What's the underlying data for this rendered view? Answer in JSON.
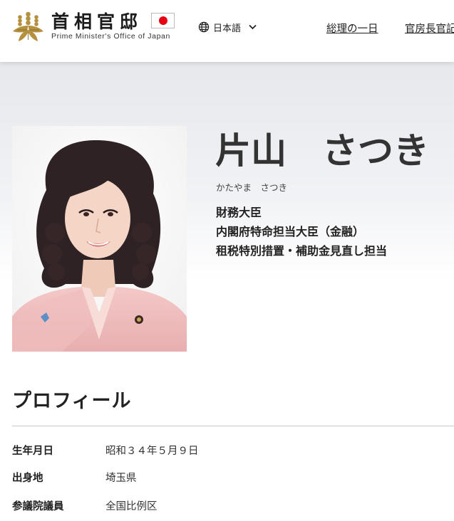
{
  "header": {
    "logo_title": "首相官邸",
    "logo_subtitle": "Prime Minister's Office of Japan",
    "language_label": "日本語",
    "nav_links": [
      "総理の一日",
      "官房長官記"
    ]
  },
  "minister": {
    "name": "片山　さつき",
    "name_kana": "かたやま　さつき",
    "roles": [
      "財務大臣",
      "内閣府特命担当大臣（金融）",
      "租税特別措置・補助金見直し担当"
    ]
  },
  "profile": {
    "title": "プロフィール",
    "rows": [
      {
        "label": "生年月日",
        "value": "昭和３４年５月９日"
      },
      {
        "label": "出身地",
        "value": "埼玉県"
      },
      {
        "label": "参議院議員",
        "value": "全国比例区"
      }
    ]
  },
  "colors": {
    "flag_red": "#e60012",
    "emblem_gold": "#b5913f",
    "hero_background": "#e6e8ec"
  }
}
